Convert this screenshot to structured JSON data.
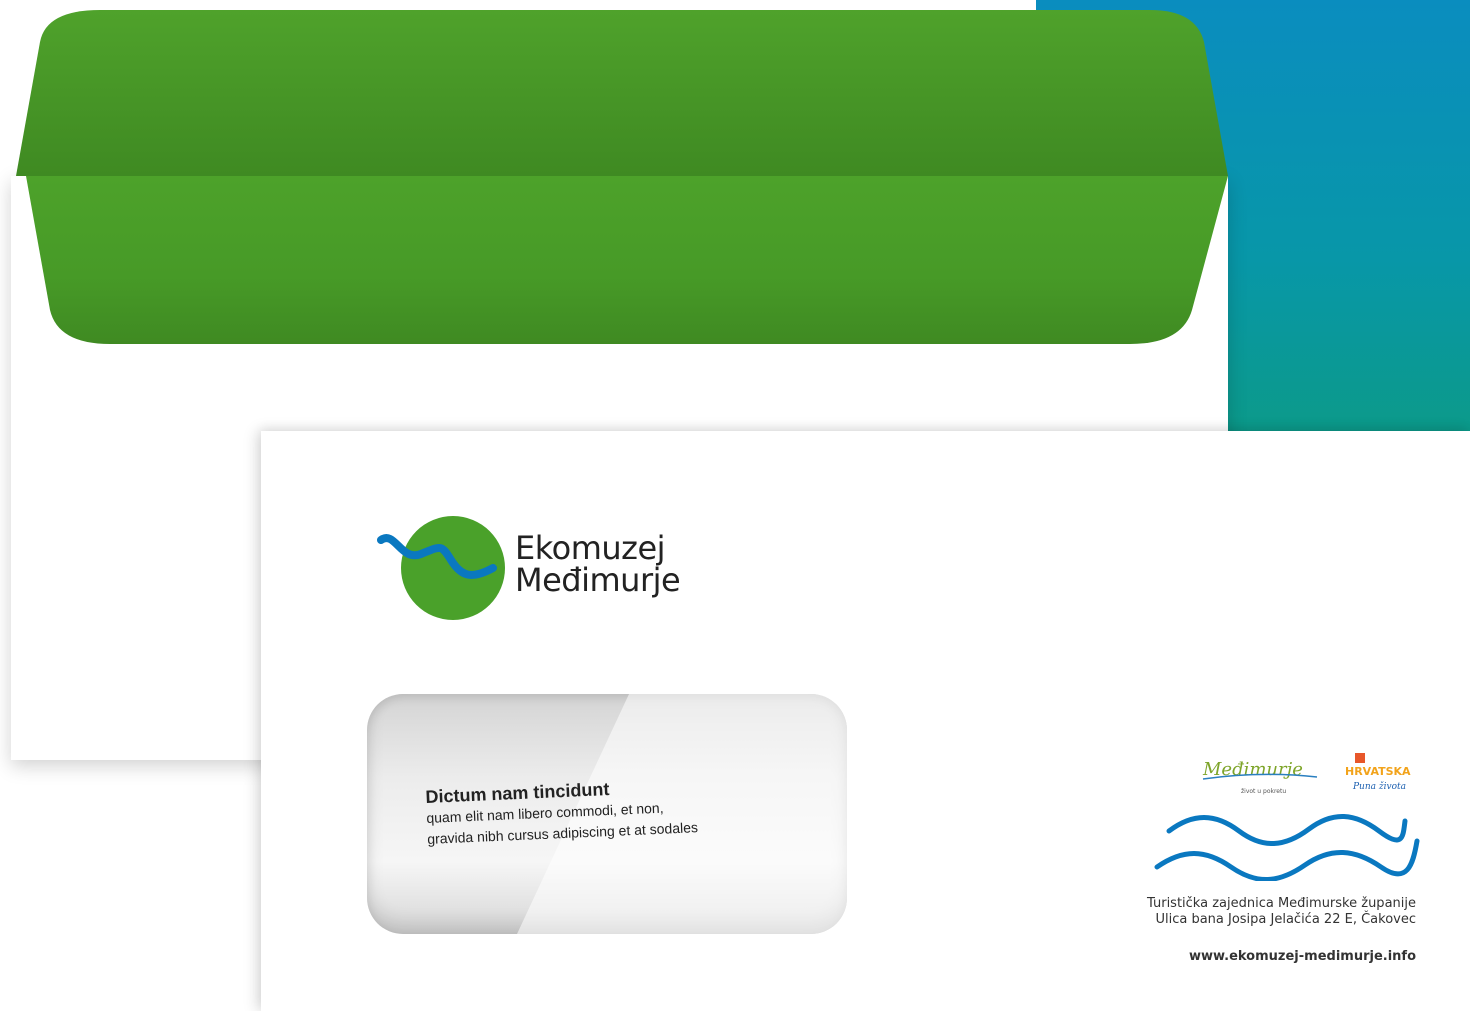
{
  "colors": {
    "brand_green": "#4aa12a",
    "brand_blue": "#0a78c0",
    "background_block": "#0a8dbf"
  },
  "logo": {
    "line1": "Ekomuzej",
    "line2": "Međimurje"
  },
  "address_window": {
    "title": "Dictum nam tincidunt",
    "line1": "quam elit nam libero commodi, et non,",
    "line2": "gravida nibh cursus adipiscing et at sodales"
  },
  "partners": {
    "medimurje_logo": "Međimurje",
    "medimurje_tagline": "život u pokretu",
    "hrvatska_logo": "HRVATSKA",
    "hrvatska_tagline": "Puna života"
  },
  "sender": {
    "organization": "Turistička zajednica Međimurske županije",
    "address": "Ulica bana Josipa Jelačića 22 E, Čakovec",
    "website": "www.ekomuzej-medimurje.info"
  },
  "icons": [
    "ekomuzej-logo-mark",
    "wave-icon"
  ]
}
